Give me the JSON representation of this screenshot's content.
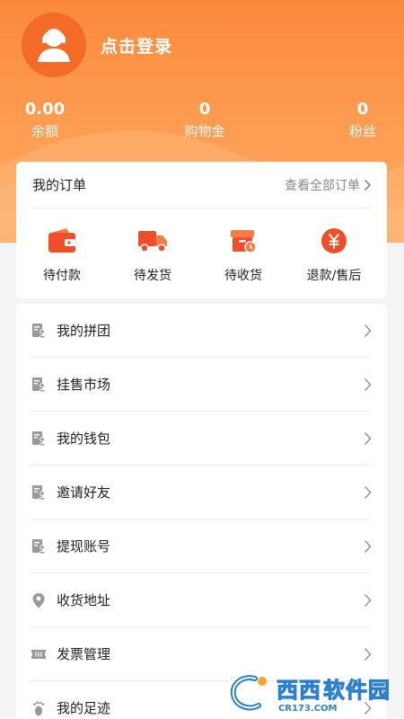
{
  "profile": {
    "login_text": "点击登录"
  },
  "stats": [
    {
      "value": "0.00",
      "label": "余额"
    },
    {
      "value": "0",
      "label": "购物金"
    },
    {
      "value": "0",
      "label": "粉丝"
    }
  ],
  "orders": {
    "title": "我的订单",
    "view_all": "查看全部订单",
    "items": [
      {
        "label": "待付款",
        "icon": "wallet-icon"
      },
      {
        "label": "待发货",
        "icon": "truck-icon"
      },
      {
        "label": "待收货",
        "icon": "package-clock-icon"
      },
      {
        "label": "退款/售后",
        "icon": "yen-coin-icon"
      }
    ]
  },
  "menu": [
    {
      "label": "我的拼团",
      "icon": "document-user-icon"
    },
    {
      "label": "挂售市场",
      "icon": "document-user-icon"
    },
    {
      "label": "我的钱包",
      "icon": "document-user-icon"
    },
    {
      "label": "邀请好友",
      "icon": "document-user-icon"
    },
    {
      "label": "提现账号",
      "icon": "document-user-icon"
    },
    {
      "label": "收货地址",
      "icon": "location-pin-icon"
    },
    {
      "label": "发票管理",
      "icon": "ticket-icon"
    },
    {
      "label": "我的足迹",
      "icon": "footprint-icon"
    }
  ],
  "watermark": {
    "brand": "西西",
    "site": "软件园",
    "sub": "CR173.COM"
  },
  "colors": {
    "accent": "#f26b27",
    "header_start": "#fb8a3c",
    "header_end": "#fdae68"
  }
}
